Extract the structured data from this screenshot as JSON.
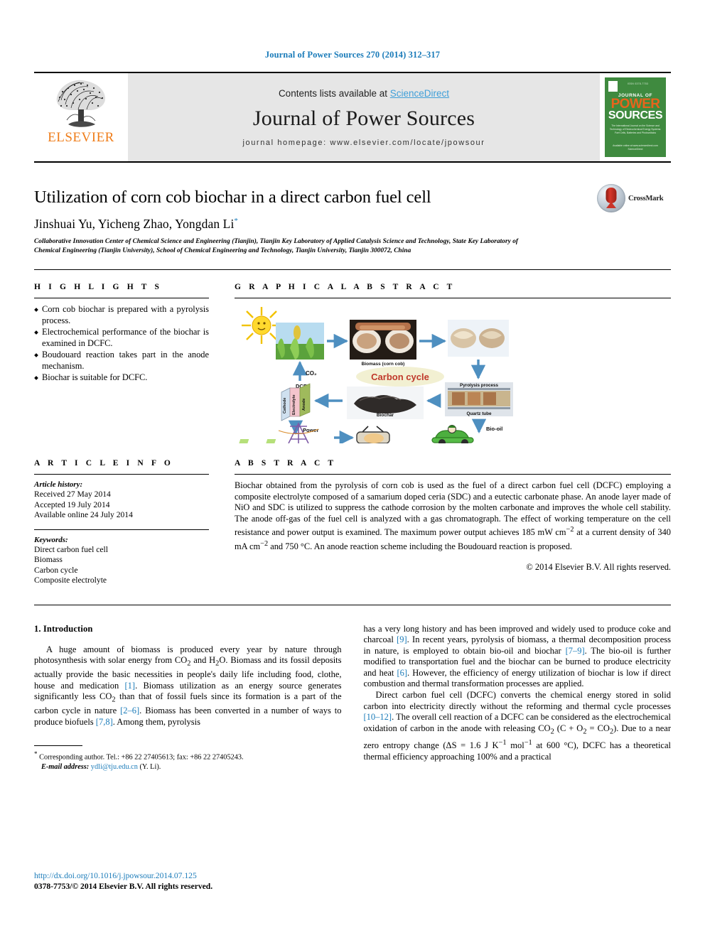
{
  "running_head": "Journal of Power Sources 270 (2014) 312–317",
  "masthead": {
    "elsevier_wordmark": "ELSEVIER",
    "contents_prefix": "Contents lists available at ",
    "sciencedirect": "ScienceDirect",
    "journal_title": "Journal of Power Sources",
    "homepage": "journal homepage: www.elsevier.com/locate/jpowsour",
    "cover": {
      "tiny_top": "ISSN 0378-7753",
      "line1": "JOURNAL OF",
      "line2": "POWER",
      "line3": "SOURCES",
      "subtitle": "The International Journal on the Science and Technology of Electrochemical Energy Systems: Fuel Cells, Batteries and Photovoltaics",
      "footer": "Available online at www.sciencedirect.com  ScienceDirect"
    },
    "accent_blue": "#3f9fd8",
    "elsevier_orange": "#ef7d1a",
    "cover_green": "#3f8a3f"
  },
  "article": {
    "title": "Utilization of corn cob biochar in a direct carbon fuel cell",
    "authors": "Jinshuai Yu, Yicheng Zhao, Yongdan Li",
    "author_star": "*",
    "affiliation": "Collaborative Innovation Center of Chemical Science and Engineering (Tianjin), Tianjin Key Laboratory of Applied Catalysis Science and Technology, State Key Laboratory of Chemical Engineering (Tianjin University), School of Chemical Engineering and Technology, Tianjin University, Tianjin 300072, China",
    "crossmark_label": "CrossMark"
  },
  "highlights": {
    "heading": "H I G H L I G H T S",
    "items": [
      "Corn cob biochar is prepared with a pyrolysis process.",
      "Electrochemical performance of the biochar is examined in DCFC.",
      "Boudouard reaction takes part in the anode mechanism.",
      "Biochar is suitable for DCFC."
    ]
  },
  "graphical_abstract": {
    "heading": "G R A P H I C A L   A B S T R A C T",
    "labels": {
      "biomass": "Biomass (corn cob)",
      "carbon_cycle": "Carbon cycle",
      "co2": "CO₂",
      "dcfc": "DCFC",
      "cathode": "Cathode",
      "electrolyte": "Electrolyte",
      "anode": "Anode",
      "biochar": "Biochar",
      "pyrolysis": "Pyrolysis process",
      "quartz_tube": "Quartz tube",
      "power": "Power",
      "bio_oil": "Bio-oil"
    }
  },
  "article_info": {
    "heading": "A R T I C L E   I N F O",
    "history_label": "Article history:",
    "history": [
      "Received 27 May 2014",
      "Accepted 19 July 2014",
      "Available online 24 July 2014"
    ],
    "keywords_label": "Keywords:",
    "keywords": [
      "Direct carbon fuel cell",
      "Biomass",
      "Carbon cycle",
      "Composite electrolyte"
    ]
  },
  "abstract": {
    "heading": "A B S T R A C T",
    "text": "Biochar obtained from the pyrolysis of corn cob is used as the fuel of a direct carbon fuel cell (DCFC) employing a composite electrolyte composed of a samarium doped ceria (SDC) and a eutectic carbonate phase. An anode layer made of NiO and SDC is utilized to suppress the cathode corrosion by the molten carbonate and improves the whole cell stability. The anode off-gas of the fuel cell is analyzed with a gas chromatograph. The effect of working temperature on the cell resistance and power output is examined. The maximum power output achieves 185 mW cm−2 at a current density of 340 mA cm−2 and 750 °C. An anode reaction scheme including the Boudouard reaction is proposed.",
    "copyright": "© 2014 Elsevier B.V. All rights reserved."
  },
  "body": {
    "section_title": "1. Introduction",
    "left_paragraph_parts": {
      "p1_a": "A huge amount of biomass is produced every year by nature through photosynthesis with solar energy from CO2 and H2O. Biomass and its fossil deposits actually provide the basic necessities in people's daily life including food, clothe, house and medication ",
      "ref1": "[1]",
      "p1_b": ". Biomass utilization as an energy source generates significantly less CO2 than that of fossil fuels since its formation is a part of the carbon cycle in nature ",
      "ref2": "[2–6]",
      "p1_c": ". Biomass has been converted in a number of ways to produce biofuels ",
      "ref3": "[7,8]",
      "p1_d": ". Among them, pyrolysis"
    },
    "right_paragraph_parts": {
      "p2_a": "has a very long history and has been improved and widely used to produce coke and charcoal ",
      "ref9": "[9]",
      "p2_b": ". In recent years, pyrolysis of biomass, a thermal decomposition process in nature, is employed to obtain bio-oil and biochar ",
      "ref79": "[7–9]",
      "p2_c": ". The bio-oil is further modified to transportation fuel and the biochar can be burned to produce electricity and heat ",
      "ref6": "[6]",
      "p2_d": ". However, the efficiency of energy utilization of biochar is low if direct combustion and thermal transformation processes are applied.",
      "p3_a": "Direct carbon fuel cell (DCFC) converts the chemical energy stored in solid carbon into electricity directly without the reforming and thermal cycle processes ",
      "ref1012": "[10–12]",
      "p3_b": ". The overall cell reaction of a DCFC can be considered as the electrochemical oxidation of carbon in the anode with releasing CO2 (C + O2 = CO2). Due to a near zero entropy change (ΔS = 1.6 J K−1 mol−1 at 600 °C), DCFC has a theoretical thermal efficiency approaching 100% and a practical"
    }
  },
  "footnote": {
    "star": "*",
    "corresponding": " Corresponding author. Tel.: +86 22 27405613; fax: +86 22 27405243.",
    "email_label": "E-mail address:",
    "email": "ydli@tju.edu.cn",
    "email_owner": "(Y. Li)."
  },
  "footer": {
    "doi": "http://dx.doi.org/10.1016/j.jpowsour.2014.07.125",
    "issn": "0378-7753/© 2014 Elsevier B.V. All rights reserved."
  }
}
